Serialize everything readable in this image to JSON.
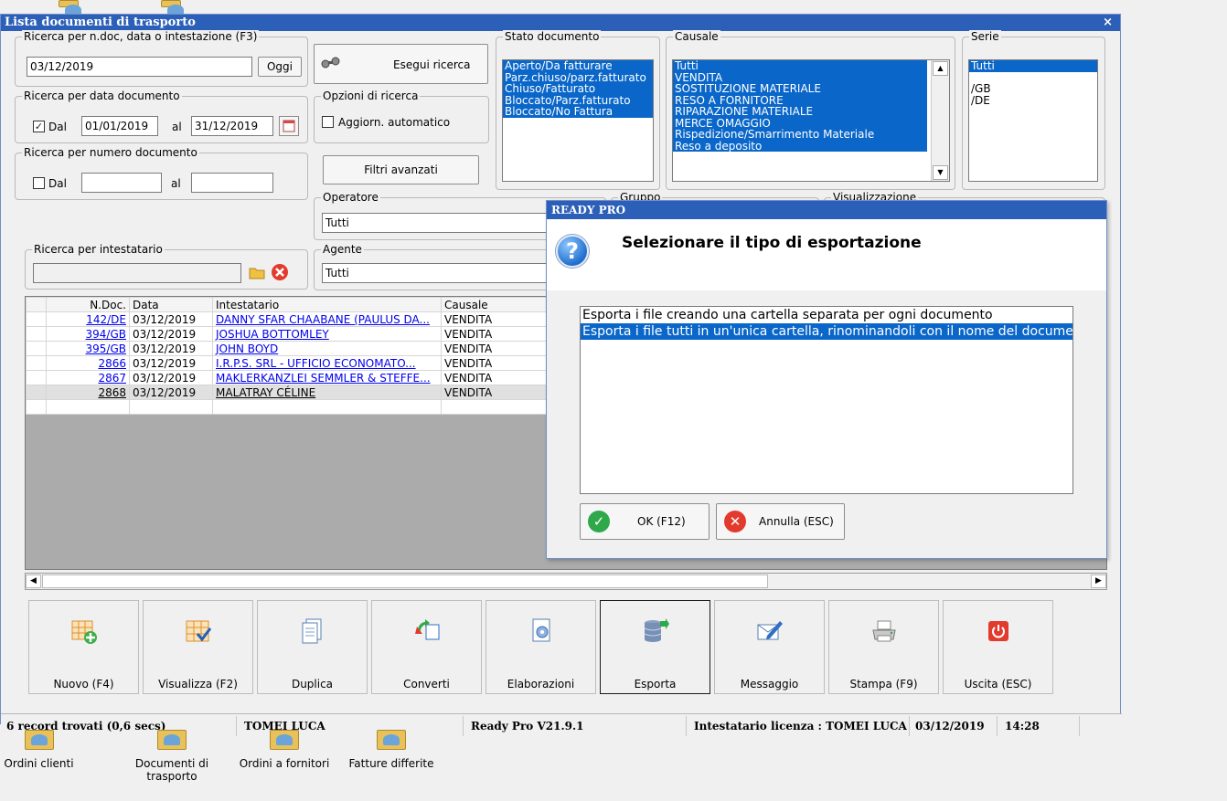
{
  "desktop": {
    "icons": [
      {
        "label": "Ordini clienti"
      },
      {
        "label": "Documenti di trasporto"
      },
      {
        "label": "Ordini a fornitori"
      },
      {
        "label": "Fatture differite"
      }
    ]
  },
  "window": {
    "title": "Lista documenti di trasporto",
    "close_glyph": "×",
    "search_doc": {
      "legend": "Ricerca per n.doc, data o intestazione (F3)",
      "value": "03/12/2019",
      "today_button": "Oggi"
    },
    "run_search_button": "Esegui ricerca",
    "date_search": {
      "legend": "Ricerca per data documento",
      "checked_glyph": "✓",
      "dal_label": "Dal",
      "from": "01/01/2019",
      "al_label": "al",
      "to": "31/12/2019"
    },
    "number_search": {
      "legend": "Ricerca per numero documento",
      "dal_label": "Dal",
      "al_label": "al",
      "from": "",
      "to": ""
    },
    "search_options": {
      "legend": "Opzioni di ricerca",
      "auto_update_label": "Aggiorn. automatico"
    },
    "advanced_filters_button": "Filtri avanzati",
    "status_doc": {
      "legend": "Stato documento",
      "items": [
        "Aperto/Da fatturare",
        "Parz.chiuso/parz.fatturato",
        "Chiuso/Fatturato",
        "Bloccato/Parz.fatturato",
        "Bloccato/No Fattura"
      ]
    },
    "causale": {
      "legend": "Causale",
      "items": [
        "Tutti",
        "VENDITA",
        "SOSTITUZIONE MATERIALE",
        "RESO A FORNITORE",
        "RIPARAZIONE MATERIALE",
        "MERCE OMAGGIO",
        "Rispedizione/Smarrimento Materiale",
        "Reso a deposito"
      ]
    },
    "serie": {
      "legend": "Serie",
      "items": [
        "Tutti",
        "",
        "/GB",
        "/DE"
      ]
    },
    "operatore": {
      "legend": "Operatore",
      "value": "Tutti"
    },
    "gruppo": {
      "legend": "Gruppo"
    },
    "visualizzazione": {
      "legend": "Visualizzazione"
    },
    "agente": {
      "legend": "Agente",
      "value": "Tutti"
    },
    "holder_search": {
      "legend": "Ricerca per intestatario",
      "value": ""
    },
    "table": {
      "headers": [
        "N.Doc.",
        "Data",
        "Intestatario",
        "Causale"
      ],
      "rows": [
        {
          "ndoc": "142/DE",
          "data": "03/12/2019",
          "intestatario": "DANNY SFAR CHAABANE (PAULUS DA...",
          "causale": "VENDITA"
        },
        {
          "ndoc": "394/GB",
          "data": "03/12/2019",
          "intestatario": "JOSHUA BOTTOMLEY",
          "causale": "VENDITA"
        },
        {
          "ndoc": "395/GB",
          "data": "03/12/2019",
          "intestatario": "JOHN BOYD",
          "causale": "VENDITA"
        },
        {
          "ndoc": "2866",
          "data": "03/12/2019",
          "intestatario": "I.R.P.S. SRL - UFFICIO ECONOMATO...",
          "causale": "VENDITA"
        },
        {
          "ndoc": "2867",
          "data": "03/12/2019",
          "intestatario": "MAKLERKANZLEI SEMMLER & STEFFE...",
          "causale": "VENDITA"
        },
        {
          "ndoc": "2868",
          "data": "03/12/2019",
          "intestatario": "MALATRAY CÉLINE",
          "causale": "VENDITA"
        }
      ]
    },
    "toolbar": [
      {
        "label": "Nuovo (F4)",
        "icon": "grid-add-icon"
      },
      {
        "label": "Visualizza (F2)",
        "icon": "grid-check-icon"
      },
      {
        "label": "Duplica",
        "icon": "document-copy-icon"
      },
      {
        "label": "Converti",
        "icon": "convert-arrows-icon"
      },
      {
        "label": "Elaborazioni",
        "icon": "document-gear-icon"
      },
      {
        "label": "Esporta",
        "icon": "database-export-icon"
      },
      {
        "label": "Messaggio",
        "icon": "message-pen-icon"
      },
      {
        "label": "Stampa (F9)",
        "icon": "printer-icon"
      },
      {
        "label": "Uscita (ESC)",
        "icon": "power-icon"
      }
    ],
    "status_bar": {
      "records": "6 record trovati (0,6 secs)",
      "user": "TOMEI LUCA",
      "version": "Ready Pro V21.9.1",
      "license": "Intestatario licenza : TOMEI LUCA",
      "date": "03/12/2019",
      "time": "14:28"
    }
  },
  "dialog": {
    "title": "READY PRO",
    "message": "Selezionare il tipo di esportazione",
    "question_glyph": "?",
    "options": [
      "Esporta i file creando una cartella separata per ogni documento",
      "Esporta i file tutti in un'unica cartella, rinominandoli con il nome del documento"
    ],
    "selected_index": 1,
    "ok_button": "OK (F12)",
    "cancel_button": "Annulla (ESC)",
    "colors": {
      "ok": "#2fa84a",
      "cancel": "#e23b2e",
      "selection": "#0a67c9",
      "titlebar": "#2b5fb8"
    }
  }
}
